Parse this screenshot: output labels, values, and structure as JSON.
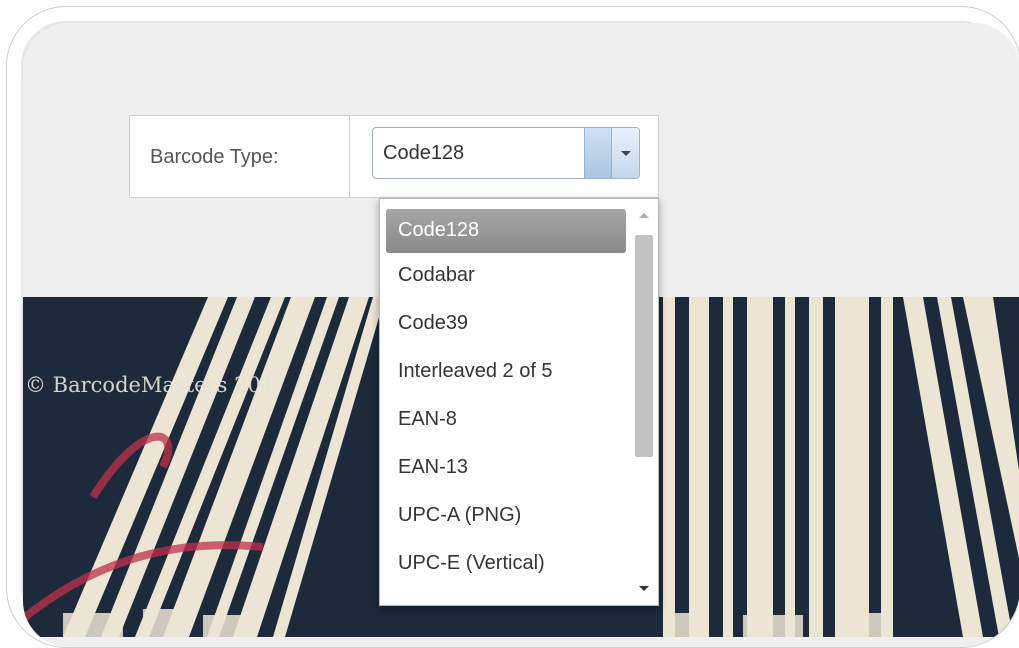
{
  "form": {
    "label": "Barcode Type:",
    "selected_value": "Code128"
  },
  "dropdown": {
    "options": [
      "Code128",
      "Codabar",
      "Code39",
      "Interleaved 2 of 5",
      "EAN-8",
      "EAN-13",
      "UPC-A (PNG)",
      "UPC-E (Vertical)"
    ],
    "selected_index": 0
  },
  "footer": {
    "copyright": "© BarcodeMasters 201"
  },
  "colors": {
    "page_bg": "#efefef",
    "banner_bg": "#1c2a3b",
    "bar_color": "#efe8d8",
    "accent_red": "#c0304a",
    "selected_option_bg": "#999999",
    "combo_border": "#9ab3cc"
  },
  "icons": {
    "combo_arrow": "chevron-down-icon",
    "scroll_up": "scroll-up-arrow-icon",
    "scroll_down": "scroll-down-arrow-icon"
  }
}
